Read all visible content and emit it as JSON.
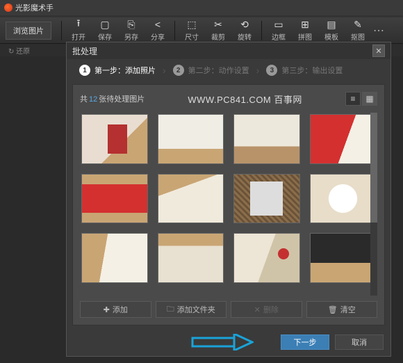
{
  "app": {
    "title": "光影魔术手"
  },
  "toolbar": {
    "browse": "浏览图片",
    "items": [
      {
        "icon": "⭱",
        "label": "打开"
      },
      {
        "icon": "▢",
        "label": "保存"
      },
      {
        "icon": "⎘",
        "label": "另存"
      },
      {
        "icon": "<",
        "label": "分享"
      },
      {
        "icon": "⬚",
        "label": "尺寸"
      },
      {
        "icon": "✂",
        "label": "裁剪"
      },
      {
        "icon": "⟲",
        "label": "旋转"
      },
      {
        "icon": "▭",
        "label": "边框"
      },
      {
        "icon": "⊞",
        "label": "拼图"
      },
      {
        "icon": "▤",
        "label": "模板"
      },
      {
        "icon": "✎",
        "label": "抠图"
      }
    ],
    "more": "⋯"
  },
  "subbar": {
    "item": "↻ 还原"
  },
  "dialog": {
    "title": "批处理",
    "steps": [
      {
        "num": "1",
        "label": "第一步：添加照片",
        "active": true
      },
      {
        "num": "2",
        "label": "第二步：动作设置",
        "active": false
      },
      {
        "num": "3",
        "label": "第三步：输出设置",
        "active": false
      }
    ],
    "count_prefix": "共",
    "count_num": "12",
    "count_suffix": "张待处理图片",
    "watermark": "WWW.PC841.COM 百事网",
    "actions": {
      "add": "添加",
      "add_folder": "添加文件夹",
      "delete": "删除",
      "clear": "清空"
    },
    "footer": {
      "next": "下一步",
      "cancel": "取消"
    }
  }
}
